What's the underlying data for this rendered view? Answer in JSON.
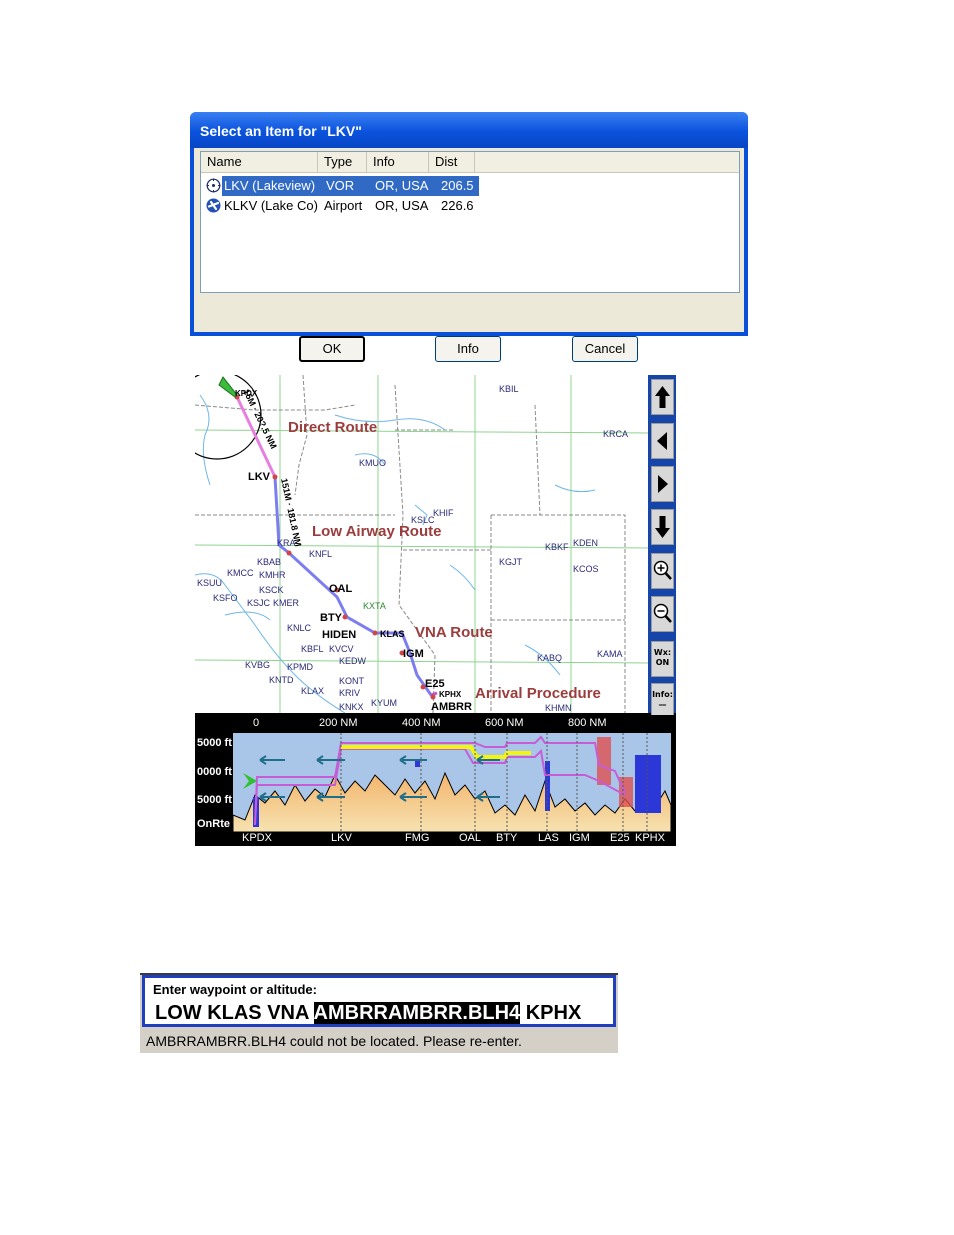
{
  "dialog": {
    "title": "Select an Item for \"LKV\"",
    "columns": [
      "Name",
      "Type",
      "Info",
      "Dist"
    ],
    "rows": [
      {
        "name": "LKV (Lakeview)",
        "type": "VOR",
        "info": "OR, USA",
        "dist": "206.5",
        "icon": "vor-icon",
        "selected": true
      },
      {
        "name": "KLKV (Lake Co)",
        "type": "Airport",
        "info": "OR, USA",
        "dist": "226.6",
        "icon": "airport-icon",
        "selected": false
      }
    ],
    "buttons": {
      "ok": "OK",
      "info": "Info",
      "cancel": "Cancel"
    }
  },
  "map": {
    "route_labels": {
      "direct": "Direct Route",
      "low_airway": "Low Airway Route",
      "vna": "VNA Route",
      "arrival": "Arrival Procedure"
    },
    "leg_labels": {
      "leg1": "15M · 20?.5 NM",
      "leg2": "151M · 181.8 NM"
    },
    "waypoints": [
      "KPDX",
      "LKV",
      "OAL",
      "BTY",
      "HIDEN",
      "KLAS",
      "IGM",
      "E25",
      "KPHX",
      "AMBRR"
    ],
    "airports": [
      "KBIL",
      "KRCA",
      "KMUO",
      "KHIF",
      "KSLC",
      "KDEN",
      "KBKF",
      "KGJT",
      "KCOS",
      "KNFL",
      "KBAB",
      "KMCC",
      "KMHR",
      "KSUU",
      "KSCK",
      "KSFO",
      "KSJC",
      "KMER",
      "KXTA",
      "KNLC",
      "KBFL",
      "KVCV",
      "KEDW",
      "KVBG",
      "KPMD",
      "KABQ",
      "KAMA",
      "KNTD",
      "KONT",
      "KLAX",
      "KRIV",
      "KYUM",
      "KNKX",
      "KHMN",
      "KRA"
    ],
    "side_buttons": {
      "wx": "Wx:\nON",
      "info": "Info:\n—"
    },
    "colors": {
      "direct": "#e77fe0",
      "airway": "#6f6ff2",
      "procedure": "#c94fc9",
      "label": "#9b3d3d"
    }
  },
  "profile": {
    "altitude_labels": [
      "5000 ft",
      "0000 ft",
      "5000 ft",
      "OnRte"
    ],
    "distance_labels": [
      "0",
      "200 NM",
      "400 NM",
      "600 NM",
      "800 NM"
    ],
    "waypoint_labels": [
      "KPDX",
      "LKV",
      "FMG",
      "OAL",
      "BTY",
      "LAS",
      "IGM",
      "E25",
      "KPHX"
    ]
  },
  "entry": {
    "prompt": "Enter waypoint or altitude:",
    "before": "LOW KLAS VNA ",
    "highlighted": "AMBRRAMBRR.BLH4",
    "after": " KPHX",
    "message": "AMBRRAMBRR.BLH4 could not be located. Please re-enter."
  }
}
